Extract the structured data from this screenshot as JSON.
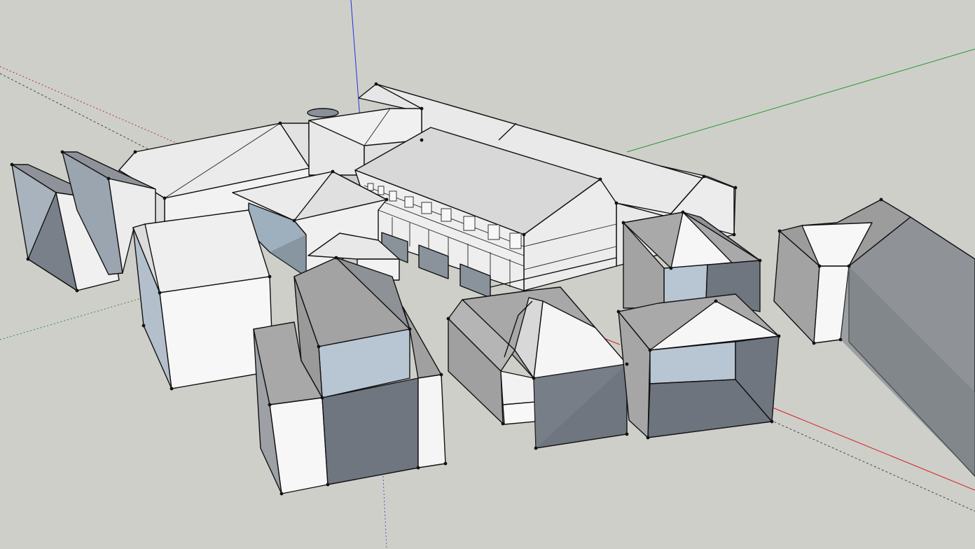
{
  "app": {
    "title": ""
  },
  "viewport": {
    "background": "#cfcfca",
    "axes": {
      "red": "#d22020",
      "green": "#1f9b2a",
      "blue": "#2231d8",
      "dashed_inferred": "#555555"
    },
    "face_colors": {
      "white": "#f4f4f4",
      "light": "#e4e4e4",
      "mid": "#cdcdcd",
      "grey": "#a9a9a9",
      "dark_grey": "#8e9196",
      "slate": "#6f7680",
      "blue_grey": "#b7c6d2",
      "blue_interior": "#9fb0bf"
    },
    "model": {
      "description": ""
    }
  }
}
